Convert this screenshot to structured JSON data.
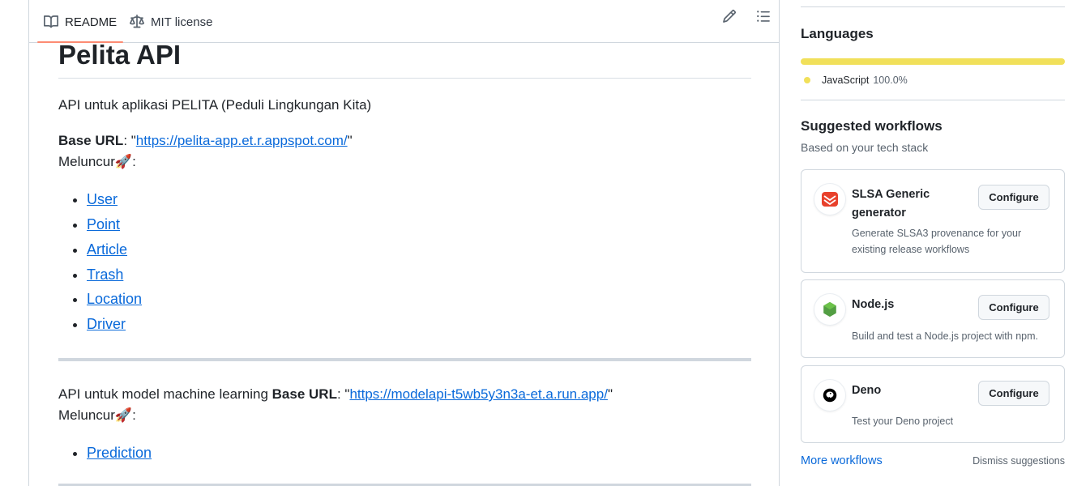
{
  "readme": {
    "tabs": [
      {
        "label": "README",
        "icon": "book-icon"
      },
      {
        "label": "MIT license",
        "icon": "scale-icon"
      }
    ],
    "actions": [
      "pencil-icon",
      "list-icon"
    ],
    "title": "Pelita API",
    "intro": "API untuk aplikasi PELITA (Peduli Lingkungan Kita)",
    "section1": {
      "base_label": "Base URL",
      "colon": ": \"",
      "base_url": "https://pelita-app.et.r.appspot.com/",
      "quote_end": "\"",
      "launch": "Meluncur",
      "launch_emoji": "🚀",
      "launch_colon": ":",
      "links": [
        "User",
        "Point",
        "Article",
        "Trash",
        "Location",
        "Driver"
      ]
    },
    "section2": {
      "lead": "API untuk model machine learning ",
      "base_label": "Base URL",
      "colon": ": \"",
      "base_url": "https://modelapi-t5wb5y3n3a-et.a.run.app/",
      "quote_end": "\"",
      "launch": "Meluncur",
      "launch_emoji": "🚀",
      "launch_colon": ":",
      "links": [
        "Prediction"
      ]
    }
  },
  "sidebar": {
    "languages": {
      "title": "Languages",
      "items": [
        {
          "name": "JavaScript",
          "percent": "100.0%",
          "color": "#f1e05a",
          "share": 1.0
        }
      ]
    },
    "workflows": {
      "title": "Suggested workflows",
      "subtitle": "Based on your tech stack",
      "cards": [
        {
          "title": "SLSA Generic generator",
          "desc": "Generate SLSA3 provenance for your existing release workflows",
          "button": "Configure",
          "icon": "slsa-icon"
        },
        {
          "title": "Node.js",
          "desc": "Build and test a Node.js project with npm.",
          "button": "Configure",
          "icon": "nodejs-icon"
        },
        {
          "title": "Deno",
          "desc": "Test your Deno project",
          "button": "Configure",
          "icon": "deno-icon"
        }
      ],
      "more": "More workflows",
      "dismiss": "Dismiss suggestions"
    }
  }
}
